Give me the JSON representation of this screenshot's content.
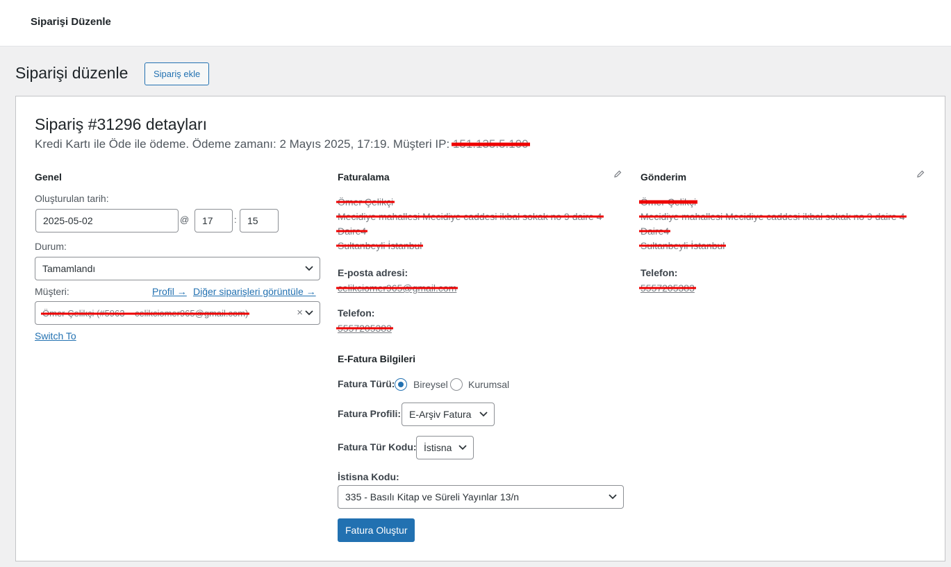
{
  "topbar": {
    "title": "Siparişi Düzenle"
  },
  "page": {
    "title": "Siparişi düzenle",
    "add_button": "Sipariş ekle"
  },
  "order": {
    "heading": "Sipariş #31296 detayları",
    "meta": "Kredi Kartı ile Öde ile ödeme. Ödeme zamanı: 2 Mayıs 2025, 17:19. Müşteri IP:",
    "ip": "151.135.5.100"
  },
  "general": {
    "heading": "Genel",
    "created_label": "Oluşturulan tarih:",
    "date_value": "2025-05-02",
    "at_symbol": "@",
    "hour": "17",
    "colon": ":",
    "minute": "15",
    "status_label": "Durum:",
    "status_value": "Tamamlandı",
    "customer_label": "Müşteri:",
    "profile_link": "Profil →",
    "other_orders_link": "Diğer siparişleri görüntüle →",
    "customer_value": "Ömer Çelikçi (#5963 – celikciomer965@gmail.com)",
    "clear_symbol": "×",
    "switch_to": "Switch To"
  },
  "billing": {
    "heading": "Faturalama",
    "name": "Ömer Çelikçi",
    "address1": "Mecidiye mahallesi Mecidiye caddesi ikbal sokak no 9 daire 4",
    "address2": "Daire4",
    "city": "Sultanbeyli İstanbul",
    "email_label": "E-posta adresi:",
    "email": "celikciomer965@gmail.com",
    "phone_label": "Telefon:",
    "phone": "5557205383"
  },
  "shipping": {
    "heading": "Gönderim",
    "name": "Ömer Çelikçi",
    "address1": "Mecidiye mahallesi Mecidiye caddesi ikbal sokak no 9 daire 4",
    "address2": "Daire4",
    "city": "Sultanbeyli İstanbul",
    "phone_label": "Telefon:",
    "phone": "5557205383"
  },
  "efatura": {
    "heading": "E-Fatura Bilgileri",
    "type_label": "Fatura Türü:",
    "type_options": [
      "Bireysel",
      "Kurumsal"
    ],
    "type_selected": "Bireysel",
    "profile_label": "Fatura Profili:",
    "profile_value": "E-Arşiv Fatura",
    "type_code_label": "Fatura Tür Kodu:",
    "type_code_value": "İstisna",
    "exemption_label": "İstisna Kodu:",
    "exemption_value": "335 - Basılı Kitap ve Süreli Yayınlar 13/n",
    "create_button": "Fatura Oluştur"
  },
  "colors": {
    "accent": "#2271b1",
    "redaction": "#e00000",
    "background": "#f0f0f1"
  }
}
